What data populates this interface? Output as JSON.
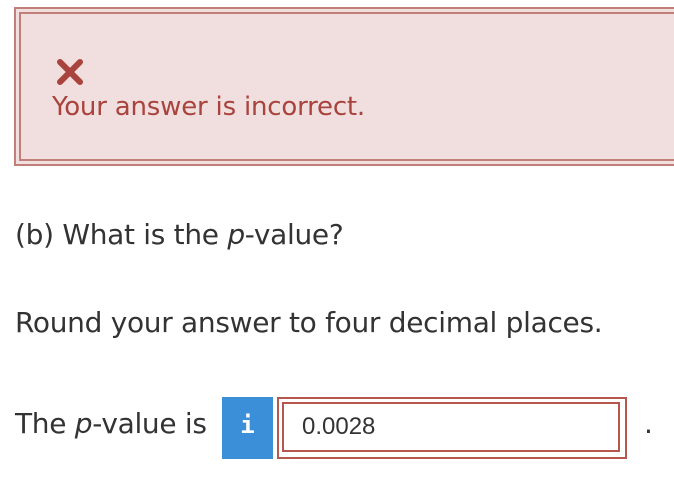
{
  "feedback": {
    "icon": "x-mark-icon",
    "message": "Your answer is incorrect.",
    "color": "#a8433d",
    "background": "#f1dede"
  },
  "question": {
    "part_prefix": "(b) What is the ",
    "part_var": "p",
    "part_suffix": "-value?",
    "instruction": "Round your answer to four decimal places."
  },
  "answer": {
    "label_prefix": "The ",
    "label_var": "p",
    "label_suffix": "-value is",
    "info_icon": "info-icon",
    "info_glyph": "i",
    "value": "0.0028",
    "trailing": "."
  }
}
